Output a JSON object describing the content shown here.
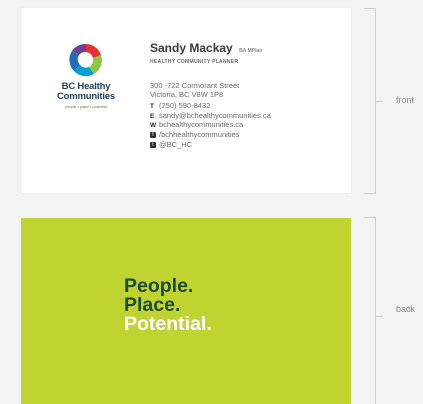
{
  "front": {
    "logo": {
      "name_line1": "BC Healthy",
      "name_line2": "Communities",
      "tagline": "people • place • potential",
      "colors": [
        "#e8312f",
        "#8dc63f",
        "#00a1d6",
        "#6a3f97"
      ]
    },
    "person": {
      "name": "Sandy Mackay",
      "credentials": "BA MPlan",
      "title": "HEALTHY COMMUNITY PLANNER"
    },
    "address": {
      "line1": "300 -722 Cormorant Street",
      "line2": "Victoria, BC  V8W 1P8"
    },
    "contacts": {
      "phone_label": "T",
      "phone": "(250) 590-8432",
      "email_label": "E",
      "email": "sandy@bchealthycommunities.ca",
      "web_label": "W",
      "web": "bchealthycommunities.ca",
      "facebook_icon": "facebook-icon",
      "facebook": "/bchhealthycommunities",
      "twitter_icon": "twitter-icon",
      "twitter": "@BC_HC"
    }
  },
  "back": {
    "line1": "People.",
    "line2": "Place.",
    "line3": "Potential.",
    "background_color": "#bfd431",
    "dark_text_color": "#1d4b38",
    "light_text_color": "#ffffff"
  },
  "labels": {
    "front": "front",
    "back": "back"
  }
}
